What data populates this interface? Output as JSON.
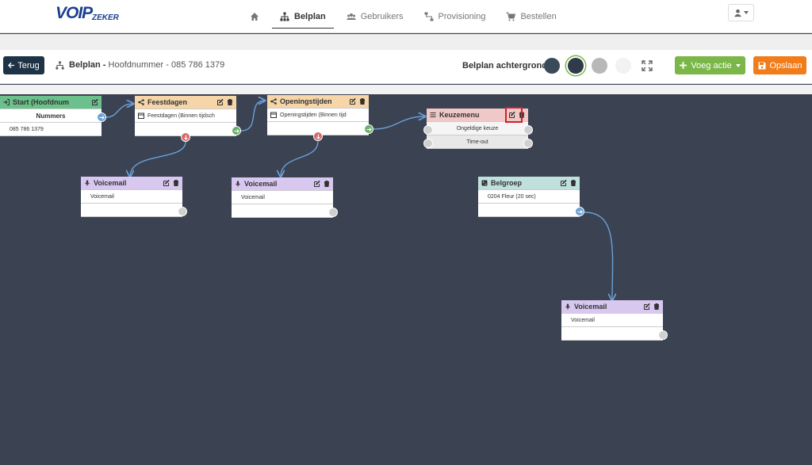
{
  "nav": {
    "logo_voip": "VOIP",
    "logo_zeker": "ZEKER",
    "items": [
      {
        "label": "",
        "icon": "home-icon"
      },
      {
        "label": "Belplan",
        "icon": "sitemap-icon",
        "active": true
      },
      {
        "label": "Gebruikers",
        "icon": "users-icon"
      },
      {
        "label": "Provisioning",
        "icon": "provisioning-icon"
      },
      {
        "label": "Bestellen",
        "icon": "cart-icon"
      }
    ]
  },
  "toolbar": {
    "back_label": "Terug",
    "title_bold": "Belplan -",
    "title_rest": "Hoofdnummer - 085 786 1379",
    "bg_label": "Belplan achtergrond",
    "bg_colors": [
      "#3b4a58",
      "#2f3a4a",
      "#b8b8b8",
      "#f2f2f2"
    ],
    "add_label": "Voeg actie",
    "save_label": "Opslaan"
  },
  "nodes": {
    "start": {
      "title": "Start (Hoofdnum",
      "header": "Nummers",
      "row": "085 786 1379",
      "color": "#6cc08b"
    },
    "feestdagen": {
      "title": "Feestdagen",
      "row": "Feestdagen (Binnen tijdsch",
      "color": "#f6d6a8"
    },
    "openingstijden": {
      "title": "Openingstijden",
      "row": "Openingstijden (Binnen tijd",
      "color": "#f6d6a8"
    },
    "keuzemenu": {
      "title": "Keuzemenu",
      "rows": [
        "Ongeldige keuze",
        "Time-out"
      ],
      "color": "#f0c8c8"
    },
    "voicemail1": {
      "title": "Voicemail",
      "row": "Voicemail",
      "color": "#d8c8f0"
    },
    "voicemail2": {
      "title": "Voicemail",
      "row": "Voicemail",
      "color": "#d8c8f0"
    },
    "belgroep": {
      "title": "Belgroep",
      "row": "0204 Fleur (20 sec)",
      "color": "#bfe0dc"
    },
    "voicemail3": {
      "title": "Voicemail",
      "row": "Voicemail",
      "color": "#d8c8f0"
    }
  }
}
